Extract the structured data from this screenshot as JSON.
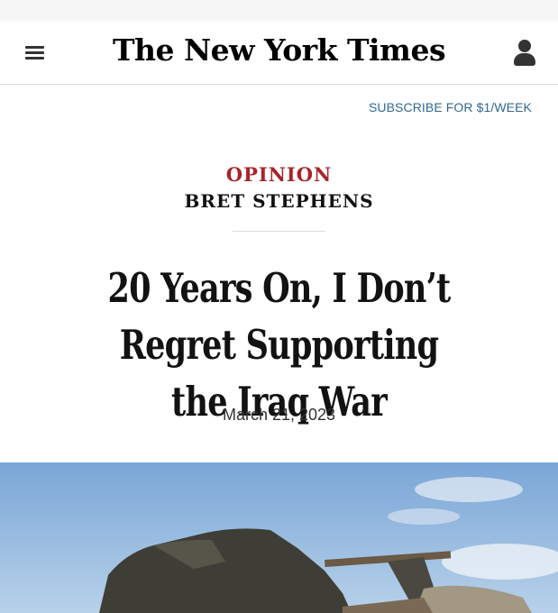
{
  "header": {
    "logo": "The New York Times",
    "menu_icon": "hamburger-menu-icon",
    "account_icon": "user-account-icon"
  },
  "promo": {
    "subscribe": "SUBSCRIBE FOR $1/WEEK"
  },
  "article": {
    "kicker": "OPINION",
    "byline": "BRET STEPHENS",
    "headline": "20 Years On, I Don’t Regret Supporting the Iraq War",
    "date": "March 21, 2023"
  },
  "colors": {
    "kicker": "#a8242c",
    "link": "#326891",
    "text": "#121212",
    "sky": "#8fb4dc"
  }
}
